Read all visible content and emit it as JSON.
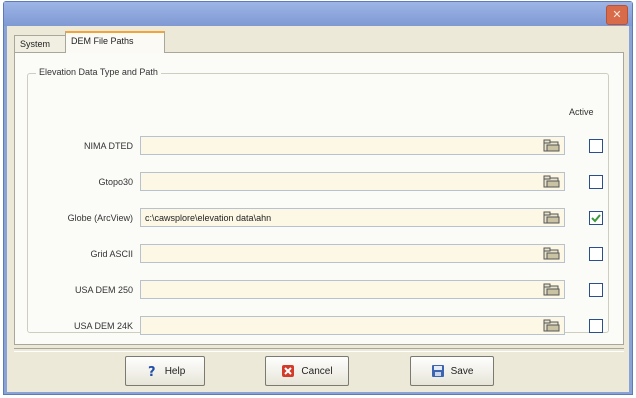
{
  "window": {
    "title": "",
    "close_glyph": "✕"
  },
  "tabs": [
    {
      "label": "System",
      "active": false
    },
    {
      "label": "DEM File Paths",
      "active": true
    }
  ],
  "group": {
    "title": "Elevation Data Type and Path",
    "active_header": "Active"
  },
  "rows": [
    {
      "label": "NIMA DTED",
      "path": "",
      "active": false
    },
    {
      "label": "Gtopo30",
      "path": "",
      "active": false
    },
    {
      "label": "Globe (ArcView)",
      "path": "c:\\cawsplore\\elevation data\\ahn",
      "active": true
    },
    {
      "label": "Grid ASCII",
      "path": "",
      "active": false
    },
    {
      "label": "USA DEM 250",
      "path": "",
      "active": false
    },
    {
      "label": "USA DEM 24K",
      "path": "",
      "active": false
    }
  ],
  "buttons": {
    "help": "Help",
    "cancel": "Cancel",
    "save": "Save"
  },
  "icons": {
    "browse": "folder-browse-icon",
    "help": "question-icon",
    "cancel": "cancel-x-icon",
    "save": "save-disk-icon"
  },
  "colors": {
    "accent_tab": "#f2a43a",
    "input_bg": "#fdf8e6",
    "checkmark": "#3a9a3a",
    "title_bar": "#8aa3d6"
  }
}
